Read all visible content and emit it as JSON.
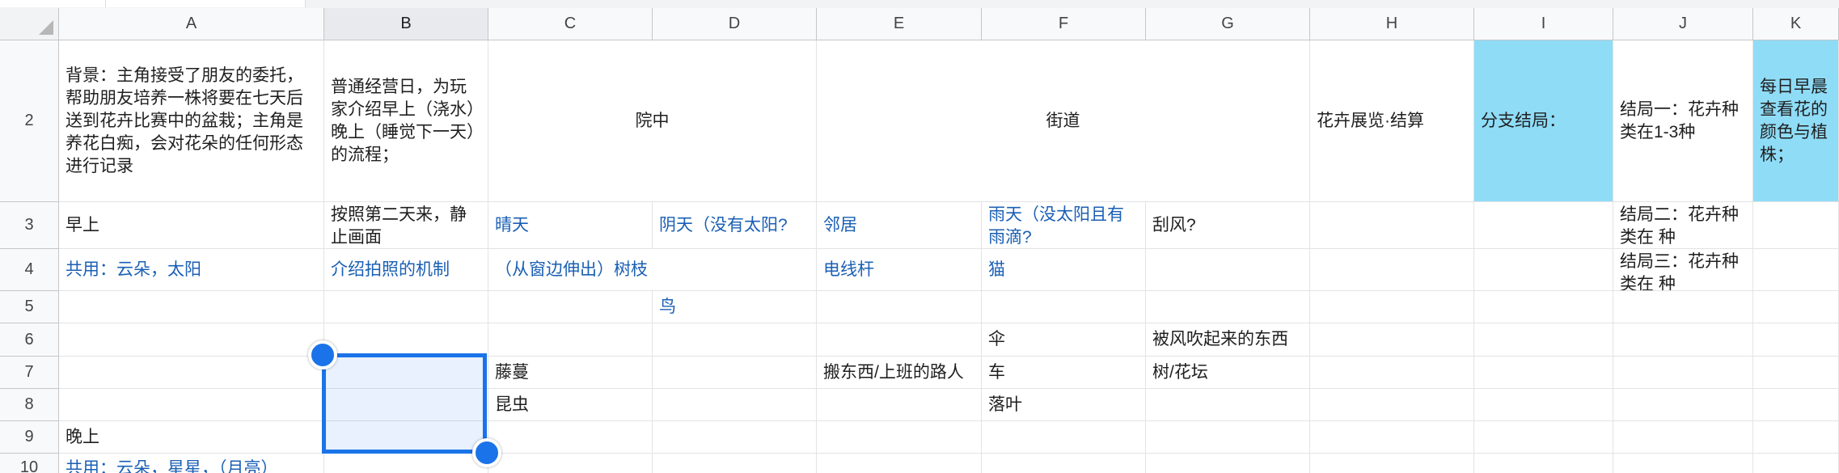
{
  "columns": [
    "A",
    "B",
    "C",
    "D",
    "E",
    "F",
    "G",
    "H",
    "I",
    "J",
    "K"
  ],
  "selected_column": "B",
  "rows": [
    "2",
    "3",
    "4",
    "5",
    "6",
    "7",
    "8",
    "9",
    "10"
  ],
  "cells": {
    "A2": "背景：主角接受了朋友的委托，帮助朋友培养一株将要在七天后送到花卉比赛中的盆栽；主角是养花白痴，会对花朵的任何形态进行记录",
    "B2": "普通经营日，为玩家介绍早上（浇水）晚上（睡觉下一天）的流程；",
    "C2": "院中",
    "E2": "街道",
    "H2": "花卉展览·结算",
    "I2": "分支结局：",
    "J2": "结局一：花卉种类在1-3种",
    "K2": "每日早晨查看花的颜色与植株；",
    "A3": "早上",
    "B3": "按照第二天来，静止画面",
    "C3": "晴天",
    "D3": "阴天（没有太阳?",
    "E3": "邻居",
    "F3": "雨天（没太阳且有雨滴?",
    "G3": "刮风?",
    "J3": "结局二：花卉种类在 种",
    "A4": "共用：云朵，太阳",
    "B4": "介绍拍照的机制",
    "C4": "（从窗边伸出）树枝",
    "E4": "电线杆",
    "F4": "猫",
    "J4": "结局三：花卉种类在 种",
    "D5": "鸟",
    "F6": "伞",
    "G6": "被风吹起来的东西",
    "C7": "藤蔓",
    "E7": "搬东西/上班的路人",
    "F7": "车",
    "G7": "树/花坛",
    "C8": "昆虫",
    "F8": "落叶",
    "A9": "晚上",
    "A10": "共用：云朵，星星，（月亮）"
  },
  "colors": {
    "accent": "#1a73e8",
    "highlight_cell": "#8fdcf7",
    "link_text": "#1a5fb4"
  }
}
